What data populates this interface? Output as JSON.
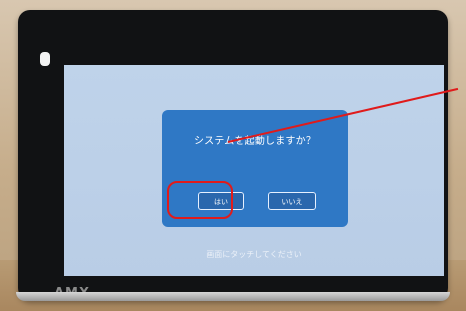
{
  "dialog": {
    "title": "システムを起動しますか？",
    "yes_label": "はい",
    "no_label": "いいえ"
  },
  "screen": {
    "hint": "画面にタッチしてください"
  },
  "brand": {
    "logo_text": "AMX"
  },
  "colors": {
    "dialog_bg": "#2f78c5",
    "screen_bg": "#bfd3ea",
    "highlight": "#e01b1b"
  }
}
